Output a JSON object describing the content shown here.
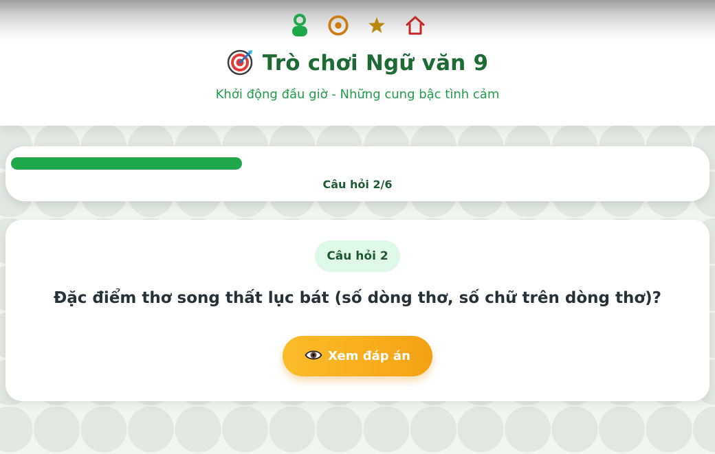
{
  "header": {
    "icons": [
      "person-icon",
      "target-ring-icon",
      "star-icon",
      "home-icon"
    ],
    "title_icon": "dartboard-icon",
    "title": "Trò chơi Ngữ văn 9",
    "subtitle": "Khởi động đầu giờ - Những cung bậc tình cảm"
  },
  "progress": {
    "current": 2,
    "total": 6,
    "fraction": 0.333,
    "label": "Câu hỏi 2/6"
  },
  "question": {
    "badge": "Câu hỏi 2",
    "text": "Đặc điểm thơ song thất lục bát (số dòng thơ, số chữ trên dòng thơ)?",
    "reveal_icon": "eye-icon",
    "reveal_label": "Xem đáp án"
  },
  "colors": {
    "title": "#1d6a35",
    "subtitle": "#1f9d47",
    "progress": "#1ea84a",
    "badge_bg": "#dff8e7",
    "button_from": "#fbbd2b",
    "button_to": "#f3a114"
  }
}
